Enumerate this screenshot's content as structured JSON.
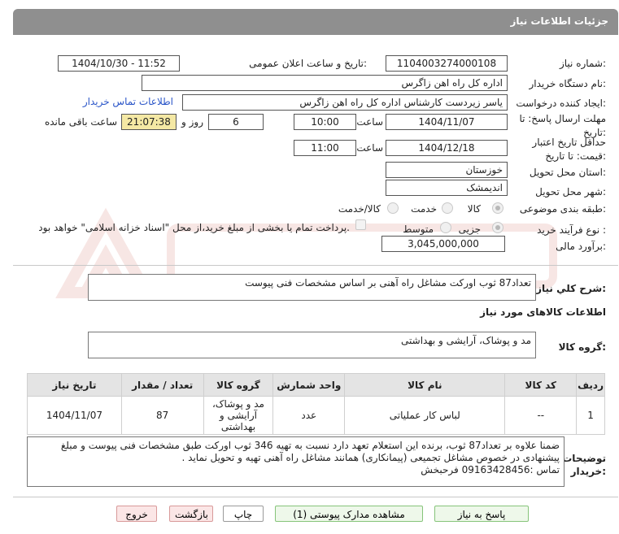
{
  "header": {
    "title": "جزئیات اطلاعات نیاز"
  },
  "fields": {
    "need_number": {
      "label": "شماره نیاز:",
      "value": "1104003274000108"
    },
    "announce_datetime": {
      "label": "تاریخ و ساعت اعلان عمومی:",
      "value": "1404/10/30 - 11:52"
    },
    "buyer_org": {
      "label": "نام دستگاه خریدار:",
      "value": "اداره کل راه اهن زاگرس"
    },
    "requester": {
      "label": "ایجاد کننده درخواست:",
      "value": "یاسر زیردست کارشناس اداره کل راه اهن زاگرس",
      "contact_link": "اطلاعات تماس خریدار"
    },
    "reply_deadline": {
      "label": "مهلت ارسال پاسخ: تا تاریخ:",
      "date": "1404/11/07",
      "time_label": "ساعت",
      "time": "10:00",
      "days": "6",
      "days_label": "روز و",
      "remaining": "21:07:38",
      "remaining_label": "ساعت باقی مانده"
    },
    "price_validity": {
      "label": "حداقل تاریخ اعتبار قیمت: تا تاریخ:",
      "date": "1404/12/18",
      "time_label": "ساعت",
      "time": "11:00"
    },
    "delivery_province": {
      "label": "استان محل تحویل:",
      "value": "خوزستان"
    },
    "delivery_city": {
      "label": "شهر محل تحویل:",
      "value": "اندیمشک"
    },
    "category": {
      "label": "طبقه بندی موضوعی:",
      "options": [
        "کالا",
        "خدمت",
        "کالا/خدمت"
      ],
      "selected": "کالا"
    },
    "purchase_process": {
      "label": "نوع فرآیند خرید :",
      "options": [
        "جزیی",
        "متوسط"
      ],
      "selected": "جزیی",
      "payment_note": "پرداخت تمام یا بخشی از مبلغ خرید،از محل \"اسناد خزانه اسلامی\" خواهد بود."
    },
    "estimate": {
      "label": "برآورد مالی:",
      "value": "3,045,000,000"
    }
  },
  "general_description": {
    "label": "شرح کلي نياز:",
    "value": "تعداد87 ثوب اورکت مشاغل راه آهنی بر اساس مشخصات فنی پیوست"
  },
  "goods_info": {
    "title": "اطلاعات کالاهای مورد نیاز",
    "group_label": "گروه کالا:",
    "group_value": "مد و پوشاک، آرایشی و بهداشتی"
  },
  "table": {
    "headers": [
      "ردیف",
      "کد کالا",
      "نام کالا",
      "واحد شمارش",
      "گروه کالا",
      "تعداد / مقدار",
      "تاریخ نیاز"
    ],
    "rows": [
      [
        "1",
        "--",
        "لباس کار عملیاتی",
        "عدد",
        "مد و پوشاک، آرایشی و بهداشتی",
        "87",
        "1404/11/07"
      ]
    ]
  },
  "buyer_notes": {
    "label": "توضیحات خریدار:",
    "lines": [
      "ضمنا علاوه بر تعداد87 ثوب، برنده این استعلام تعهد دارد نسبت به تهیه 346 ثوب اورکت طبق مشخصات فنی پیوست و مبلغ",
      "پیشنهادی در خصوص مشاغل تجمیعی (پیمانکاری) همانند مشاغل راه آهنی تهیه و تحویل نماید .",
      "تماس :09163428456 فرحبخش"
    ]
  },
  "buttons": {
    "reply": "پاسخ به نیاز",
    "attachments": "مشاهده مدارک پیوستی (1)",
    "print": "چاپ",
    "back": "بازگشت",
    "exit": "خروج"
  },
  "colors": {
    "header_bg": "#8f8f8f",
    "link": "#2a55c8",
    "remaining_bg": "#f4e8a4"
  }
}
